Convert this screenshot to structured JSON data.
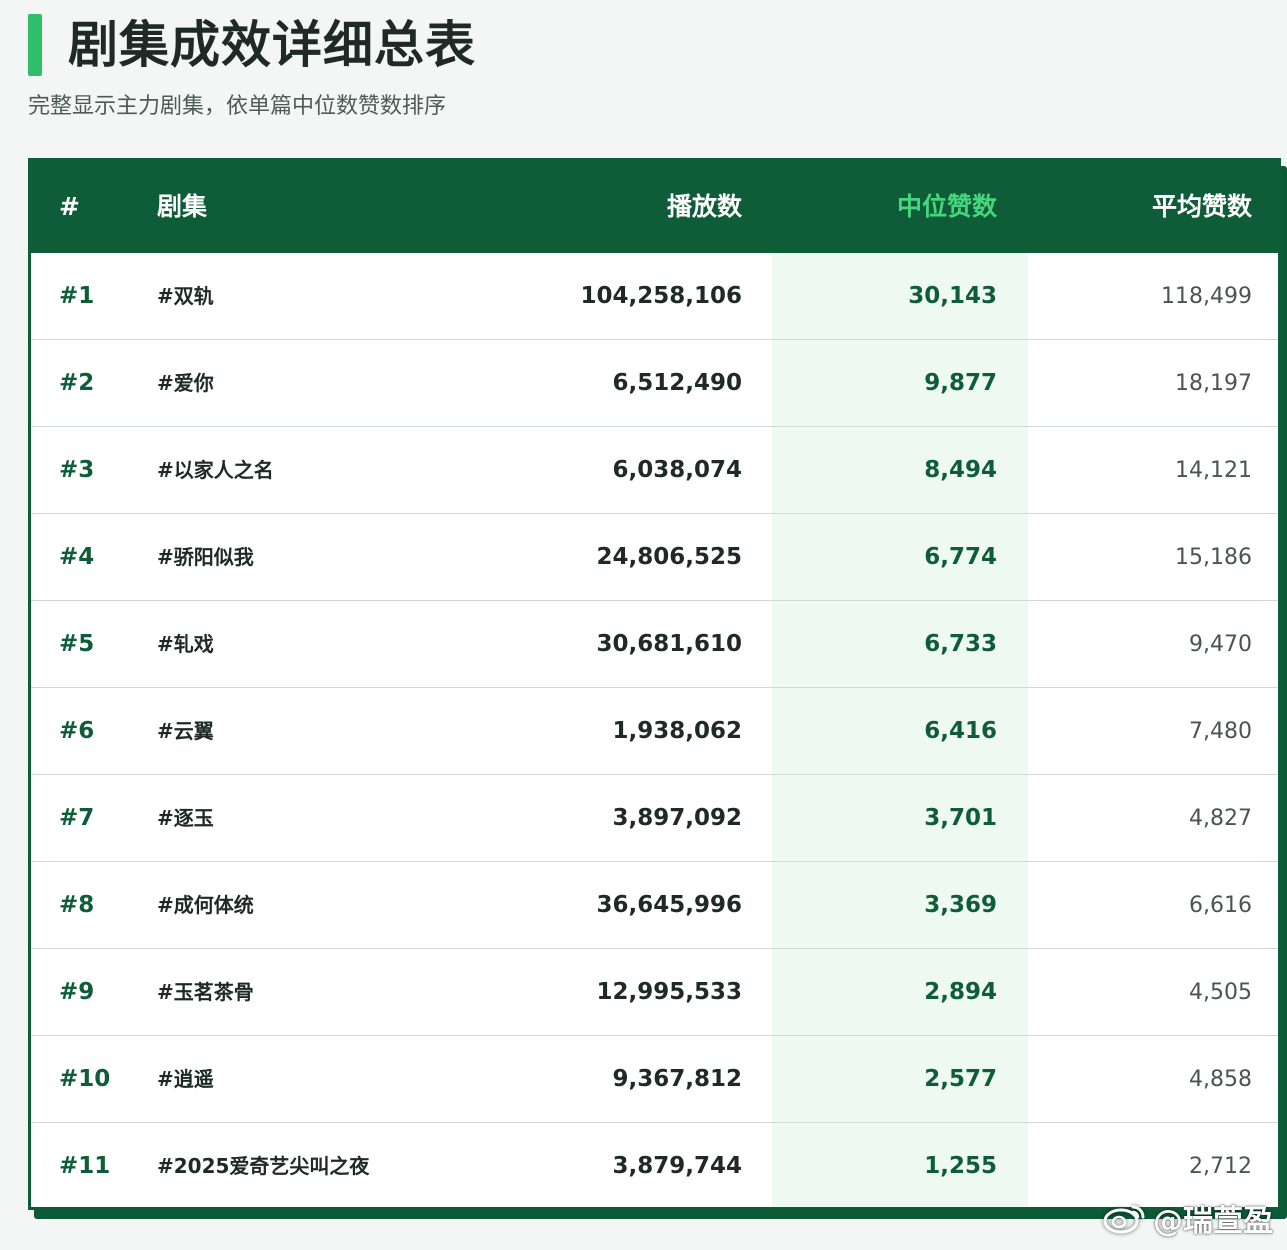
{
  "page": {
    "title": "剧集成效详细总表",
    "subtitle": "完整显示主力剧集，依单篇中位数赞数排序"
  },
  "colors": {
    "header_bg": "#0e5c38",
    "accent_green": "#2fbf6a",
    "highlight_header": "#46d67e",
    "median_band": "#eefaf1"
  },
  "table": {
    "headers": {
      "rank": "#",
      "name": "剧集",
      "plays": "播放数",
      "median_likes": "中位赞数",
      "avg_likes": "平均赞数"
    }
  },
  "chart_data": {
    "type": "table",
    "title": "剧集成效详细总表",
    "subtitle": "完整显示主力剧集，依单篇中位数赞数排序",
    "columns": [
      "#",
      "剧集",
      "播放数",
      "中位赞数",
      "平均赞数"
    ],
    "highlight_column": "中位赞数",
    "rows": [
      {
        "rank": "#1",
        "name": "#双轨",
        "plays": "104,258,106",
        "median": "30,143",
        "avg": "118,499"
      },
      {
        "rank": "#2",
        "name": "#爱你",
        "plays": "6,512,490",
        "median": "9,877",
        "avg": "18,197"
      },
      {
        "rank": "#3",
        "name": "#以家人之名",
        "plays": "6,038,074",
        "median": "8,494",
        "avg": "14,121"
      },
      {
        "rank": "#4",
        "name": "#骄阳似我",
        "plays": "24,806,525",
        "median": "6,774",
        "avg": "15,186"
      },
      {
        "rank": "#5",
        "name": "#轧戏",
        "plays": "30,681,610",
        "median": "6,733",
        "avg": "9,470"
      },
      {
        "rank": "#6",
        "name": "#云翼",
        "plays": "1,938,062",
        "median": "6,416",
        "avg": "7,480"
      },
      {
        "rank": "#7",
        "name": "#逐玉",
        "plays": "3,897,092",
        "median": "3,701",
        "avg": "4,827"
      },
      {
        "rank": "#8",
        "name": "#成何体统",
        "plays": "36,645,996",
        "median": "3,369",
        "avg": "6,616"
      },
      {
        "rank": "#9",
        "name": "#玉茗茶骨",
        "plays": "12,995,533",
        "median": "2,894",
        "avg": "4,505"
      },
      {
        "rank": "#10",
        "name": "#逍遥",
        "plays": "9,367,812",
        "median": "2,577",
        "avg": "4,858"
      },
      {
        "rank": "#11",
        "name": "#2025爱奇艺尖叫之夜",
        "plays": "3,879,744",
        "median": "1,255",
        "avg": "2,712"
      }
    ]
  },
  "watermark": {
    "icon": "weibo-icon",
    "text": "@瑞萱盈"
  }
}
